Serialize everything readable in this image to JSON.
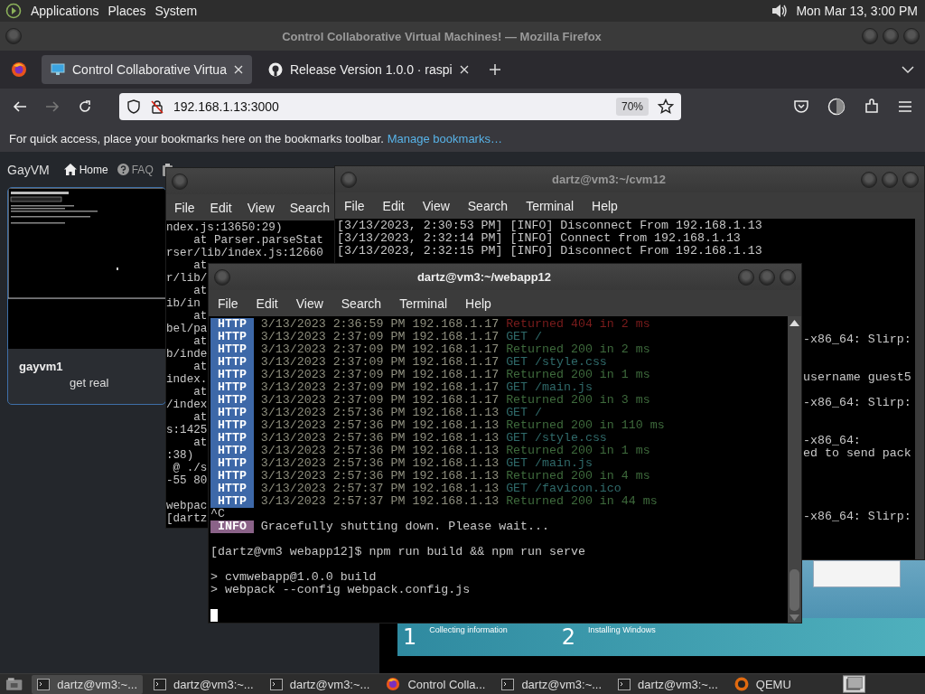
{
  "top_panel": {
    "menus": [
      "Applications",
      "Places",
      "System"
    ],
    "clock": "Mon Mar 13,  3:00 PM"
  },
  "firefox": {
    "title": "Control Collaborative Virtual Machines! — Mozilla Firefox",
    "tabs": [
      {
        "label": "Control Collaborative Virtua",
        "selected": true
      },
      {
        "label": "Release Version 1.0.0 · raspi",
        "selected": false
      }
    ],
    "url": "192.168.1.13:3000",
    "zoom": "70%",
    "bookmarks_hint": "For quick access, place your bookmarks here on the bookmarks toolbar.",
    "bookmarks_link": "Manage bookmarks…",
    "page": {
      "brand": "GayVM",
      "nav": [
        {
          "label": "Home"
        },
        {
          "label": "FAQ"
        }
      ],
      "vm_card": {
        "name": "gayvm1",
        "description": "get real"
      }
    }
  },
  "qemu_window": {
    "steps": [
      {
        "number": "1",
        "label": "Collecting information"
      },
      {
        "number": "2",
        "label": "Installing Windows"
      }
    ]
  },
  "left_terminal": {
    "menu": [
      "File",
      "Edit",
      "View",
      "Search"
    ],
    "lines": [
      "ndex.js:13650:29)",
      "    at Parser.parseStat",
      "rser/lib/index.js:12660",
      "    at",
      "r/lib/",
      "    at",
      "ib/in",
      "    at",
      "bel/pa",
      "    at",
      "b/inde",
      "    at",
      "index.",
      "    at",
      "/index",
      "    at",
      "s:1425",
      "    at",
      ":38)",
      " @ ./s",
      "-55 80",
      "webpac",
      "[dartz"
    ]
  },
  "right_terminal": {
    "title": "dartz@vm3:~/cvm12",
    "menu": [
      "File",
      "Edit",
      "View",
      "Search",
      "Terminal",
      "Help"
    ],
    "lines": [
      "[3/13/2023, 2:30:53 PM] [INFO] Disconnect From 192.168.1.13",
      "[3/13/2023, 2:32:14 PM] [INFO] Connect from 192.168.1.13",
      "[3/13/2023, 2:32:15 PM] [INFO] Disconnect From 192.168.1.13"
    ],
    "right_edge_lines": [
      "-x86_64: Slirp:",
      "username guest5",
      "-x86_64: Slirp:",
      "-x86_64:",
      "ed to send pack",
      "-x86_64: Slirp:"
    ]
  },
  "front_terminal": {
    "title": "dartz@vm3:~/webapp12",
    "menu": [
      "File",
      "Edit",
      "View",
      "Search",
      "Terminal",
      "Help"
    ],
    "http_log": [
      {
        "tag": "HTTP",
        "time": "3/13/2023 2:36:59 PM 192.168.1.17",
        "message": "Returned 404 in 2 ms",
        "color": "#7a1c1c"
      },
      {
        "tag": "HTTP",
        "time": "3/13/2023 2:37:09 PM 192.168.1.17",
        "message": "GET /",
        "color": "#2f6a6a"
      },
      {
        "tag": "HTTP",
        "time": "3/13/2023 2:37:09 PM 192.168.1.17",
        "message": "Returned 200 in 2 ms",
        "color": "#3e6a3c"
      },
      {
        "tag": "HTTP",
        "time": "3/13/2023 2:37:09 PM 192.168.1.17",
        "message": "GET /style.css",
        "color": "#2f6a6a"
      },
      {
        "tag": "HTTP",
        "time": "3/13/2023 2:37:09 PM 192.168.1.17",
        "message": "Returned 200 in 1 ms",
        "color": "#3e6a3c"
      },
      {
        "tag": "HTTP",
        "time": "3/13/2023 2:37:09 PM 192.168.1.17",
        "message": "GET /main.js",
        "color": "#2f6a6a"
      },
      {
        "tag": "HTTP",
        "time": "3/13/2023 2:37:09 PM 192.168.1.17",
        "message": "Returned 200 in 3 ms",
        "color": "#3e6a3c"
      },
      {
        "tag": "HTTP",
        "time": "3/13/2023 2:57:36 PM 192.168.1.13",
        "message": "GET /",
        "color": "#2f6a6a"
      },
      {
        "tag": "HTTP",
        "time": "3/13/2023 2:57:36 PM 192.168.1.13",
        "message": "Returned 200 in 110 ms",
        "color": "#3e6a3c"
      },
      {
        "tag": "HTTP",
        "time": "3/13/2023 2:57:36 PM 192.168.1.13",
        "message": "GET /style.css",
        "color": "#2f6a6a"
      },
      {
        "tag": "HTTP",
        "time": "3/13/2023 2:57:36 PM 192.168.1.13",
        "message": "Returned 200 in 1 ms",
        "color": "#3e6a3c"
      },
      {
        "tag": "HTTP",
        "time": "3/13/2023 2:57:36 PM 192.168.1.13",
        "message": "GET /main.js",
        "color": "#2f6a6a"
      },
      {
        "tag": "HTTP",
        "time": "3/13/2023 2:57:36 PM 192.168.1.13",
        "message": "Returned 200 in 4 ms",
        "color": "#3e6a3c"
      },
      {
        "tag": "HTTP",
        "time": "3/13/2023 2:57:37 PM 192.168.1.13",
        "message": "GET /favicon.ico",
        "color": "#2f6a6a"
      },
      {
        "tag": "HTTP",
        "time": "3/13/2023 2:57:37 PM 192.168.1.13",
        "message": "Returned 200 in 44 ms",
        "color": "#3e6a3c"
      }
    ],
    "after_lines": [
      {
        "kind": "plain",
        "text": "^C"
      },
      {
        "kind": "tagged",
        "tag": "INFO",
        "text": "Gracefully shutting down. Please wait..."
      },
      {
        "kind": "blank"
      },
      {
        "kind": "plain",
        "text": "[dartz@vm3 webapp12]$ npm run build && npm run serve"
      },
      {
        "kind": "blank"
      },
      {
        "kind": "plain",
        "text": "> cvmwebapp@1.0.0 build"
      },
      {
        "kind": "plain",
        "text": "> webpack --config webpack.config.js"
      },
      {
        "kind": "blank"
      },
      {
        "kind": "cursor"
      }
    ]
  },
  "taskbar": {
    "items": [
      {
        "label": "dartz@vm3:~...",
        "kind": "terminal",
        "selected": true
      },
      {
        "label": "dartz@vm3:~...",
        "kind": "terminal",
        "selected": false
      },
      {
        "label": "dartz@vm3:~...",
        "kind": "terminal",
        "selected": false
      },
      {
        "label": "Control Colla...",
        "kind": "browser",
        "selected": false
      },
      {
        "label": "dartz@vm3:~...",
        "kind": "terminal",
        "selected": false
      },
      {
        "label": "dartz@vm3:~...",
        "kind": "terminal",
        "selected": false
      },
      {
        "label": "QEMU",
        "kind": "emulator",
        "selected": false
      }
    ]
  }
}
